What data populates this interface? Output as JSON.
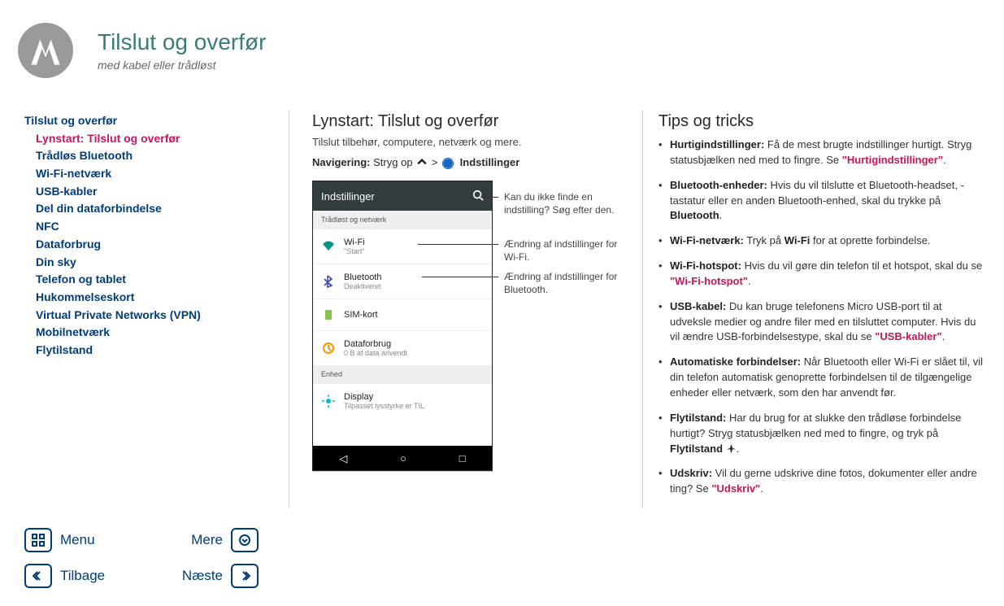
{
  "header": {
    "title": "Tilslut og overfør",
    "subtitle": "med kabel eller trådløst"
  },
  "sidebar": {
    "section": "Tilslut og overfør",
    "items": [
      {
        "label": "Lynstart: Tilslut og overfør",
        "current": true
      },
      {
        "label": "Trådløs Bluetooth"
      },
      {
        "label": "Wi-Fi-netværk"
      },
      {
        "label": "USB-kabler"
      },
      {
        "label": "Del din dataforbindelse"
      },
      {
        "label": "NFC"
      },
      {
        "label": "Dataforbrug"
      },
      {
        "label": "Din sky"
      },
      {
        "label": "Telefon og tablet"
      },
      {
        "label": "Hukommelseskort"
      },
      {
        "label": "Virtual Private Networks (VPN)"
      },
      {
        "label": "Mobilnetværk"
      },
      {
        "label": "Flytilstand"
      }
    ]
  },
  "main": {
    "heading": "Lynstart: Tilslut og overfør",
    "lead": "Tilslut tilbehør, computere, netværk og mere.",
    "nav_label": "Navigering:",
    "nav_text_1": "Stryg op",
    "nav_gt": ">",
    "nav_settings": "Indstillinger"
  },
  "phone": {
    "header": "Indstillinger",
    "section1": "Trådløst og netværk",
    "rows": [
      {
        "title": "Wi-Fi",
        "sub": "\"Start\""
      },
      {
        "title": "Bluetooth",
        "sub": "Deaktiveret"
      },
      {
        "title": "SIM-kort",
        "sub": ""
      },
      {
        "title": "Dataforbrug",
        "sub": "0 B af data anvendt"
      }
    ],
    "section2": "Enhed",
    "rows2": [
      {
        "title": "Display",
        "sub": "Tilpasset lysstyrke er TIL"
      }
    ]
  },
  "callouts": {
    "search": "Kan du ikke finde en indstilling? Søg efter den.",
    "wifi": "Ændring af indstillinger for Wi-Fi.",
    "bt": "Ændring af indstillinger for Bluetooth."
  },
  "tips": {
    "heading": "Tips og tricks",
    "items": [
      {
        "bold": "Hurtigindstillinger:",
        "text_before": " Få de mest brugte indstillinger hurtigt. Stryg statusbjælken ned med to fingre. Se ",
        "link": "\"Hurtigindstillinger\"",
        "text_after": "."
      },
      {
        "bold": "Bluetooth-enheder:",
        "text_before": " Hvis du vil tilslutte et Bluetooth-headset, -tastatur eller en anden Bluetooth-enhed, skal du trykke på ",
        "bold2": "Bluetooth",
        "text_after": "."
      },
      {
        "bold": "Wi-Fi-netværk:",
        "text_before": " Tryk på ",
        "bold2": "Wi-Fi",
        "text_after": " for at oprette forbindelse."
      },
      {
        "bold": "Wi-Fi-hotspot:",
        "text_before": " Hvis du vil gøre din telefon til et hotspot, skal du se ",
        "link": "\"Wi-Fi-hotspot\"",
        "text_after": "."
      },
      {
        "bold": "USB-kabel:",
        "text_before": " Du kan bruge telefonens Micro USB-port til at udveksle medier og andre filer med en tilsluttet computer. Hvis du vil ændre USB-forbindelsestype, skal du se ",
        "link": "\"USB-kabler\"",
        "text_after": "."
      },
      {
        "bold": "Automatiske forbindelser:",
        "text_before": " Når Bluetooth eller Wi-Fi er slået til, vil din telefon automatisk genoprette forbindelsen til de tilgængelige enheder eller netværk, som den har anvendt før."
      },
      {
        "bold": "Flytilstand:",
        "text_before": " Har du brug for at slukke den trådløse forbindelse hurtigt? Stryg statusbjælken ned med to fingre, og tryk på ",
        "bold2": "Flytilstand",
        "icon": "airplane",
        "text_after": "."
      },
      {
        "bold": "Udskriv:",
        "text_before": " Vil du gerne udskrive dine fotos, dokumenter eller andre ting? Se ",
        "link": "\"Udskriv\"",
        "text_after": "."
      }
    ]
  },
  "bottom": {
    "menu": "Menu",
    "more": "Mere",
    "back": "Tilbage",
    "next": "Næste"
  }
}
